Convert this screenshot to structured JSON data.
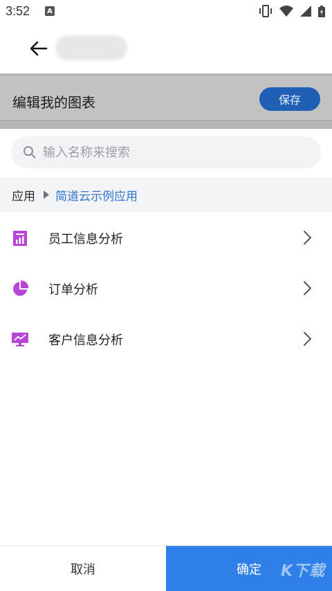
{
  "status_bar": {
    "time": "3:52",
    "notification_letter": "A",
    "icons": [
      "vibrate-icon",
      "wifi-icon",
      "signal-icon",
      "battery-icon"
    ]
  },
  "header": {
    "back_icon": "arrow-left-icon"
  },
  "edit_bar": {
    "title": "编辑我的图表",
    "save_label": "保存"
  },
  "search": {
    "placeholder": "输入名称来搜索",
    "value": ""
  },
  "breadcrumb": {
    "root": "应用",
    "current": "简道云示例应用"
  },
  "list": {
    "items": [
      {
        "label": "员工信息分析",
        "icon": "bar-chart-icon"
      },
      {
        "label": "订单分析",
        "icon": "pie-chart-icon"
      },
      {
        "label": "客户信息分析",
        "icon": "monitor-chart-icon"
      }
    ]
  },
  "bottom_bar": {
    "cancel_label": "取消",
    "confirm_label": "确定"
  },
  "watermark": "K下载",
  "colors": {
    "accent": "#2f7fe8",
    "save_button": "#1f5fb5",
    "icon_purple": "#b745d6",
    "breadcrumb_link": "#2f74d0"
  }
}
